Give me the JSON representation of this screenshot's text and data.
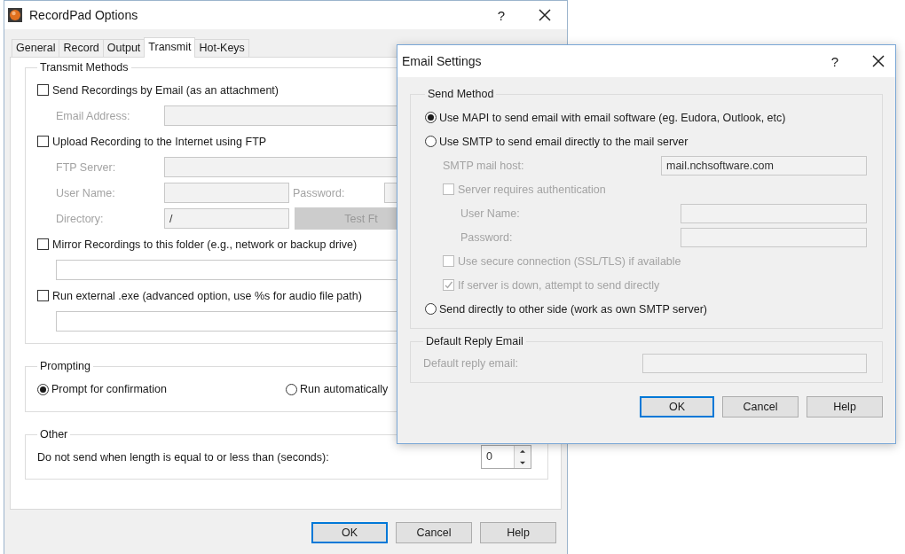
{
  "main_window": {
    "title": "RecordPad Options",
    "help": "?",
    "tabs": [
      {
        "label": "General",
        "selected": false
      },
      {
        "label": "Record",
        "selected": false
      },
      {
        "label": "Output",
        "selected": false
      },
      {
        "label": "Transmit",
        "selected": true
      },
      {
        "label": "Hot-Keys",
        "selected": false
      }
    ],
    "transmit_methods": {
      "title": "Transmit Methods",
      "rows": [
        {
          "kind": "checkbox",
          "label": "Send Recordings by Email (as an attachment)",
          "checked": false
        },
        {
          "kind": "field",
          "label": "Email Address:",
          "disabled": true
        },
        {
          "kind": "checkbox",
          "label": "Upload Recording to the Internet using FTP",
          "checked": false
        },
        {
          "kind": "field",
          "label": "FTP Server:",
          "disabled": true
        },
        {
          "kind": "field_pair",
          "fields": [
            {
              "label": "User Name:",
              "disabled": true
            },
            {
              "label": "Password:",
              "disabled": true
            }
          ]
        },
        {
          "kind": "field_button",
          "label": "Directory:",
          "value": "/",
          "disabled": true,
          "button": "Test Ft"
        },
        {
          "kind": "checkbox",
          "label": "Mirror Recordings to this folder (e.g., network or backup drive)",
          "checked": false
        },
        {
          "kind": "input"
        },
        {
          "kind": "checkbox",
          "label": "Run external .exe (advanced option, use %s for audio file path)",
          "checked": false
        },
        {
          "kind": "input"
        }
      ]
    },
    "prompting": {
      "title": "Prompting",
      "options": [
        {
          "label": "Prompt for confirmation",
          "selected": true
        },
        {
          "label": "Run automatically",
          "selected": false
        }
      ]
    },
    "other": {
      "title": "Other",
      "label": "Do not send when length is equal to or less than (seconds):",
      "value": "0"
    },
    "buttons": [
      {
        "label": "OK",
        "focused": true
      },
      {
        "label": "Cancel",
        "focused": false
      },
      {
        "label": "Help",
        "focused": false
      }
    ]
  },
  "email_settings": {
    "title": "Email Settings",
    "help": "?",
    "send_method": {
      "title": "Send Method",
      "rows": [
        {
          "kind": "radio",
          "label": "Use MAPI to send email with email software (eg. Eudora, Outlook, etc)",
          "selected": true
        },
        {
          "kind": "radio",
          "label": "Use SMTP to send email directly to the mail server",
          "selected": false,
          "children": [
            {
              "kind": "field",
              "label": "SMTP mail host:",
              "value": "mail.nchsoftware.com",
              "disabled": true
            },
            {
              "kind": "checkbox",
              "label": "Server requires authentication",
              "checked": false,
              "disabled": true,
              "children": [
                {
                  "kind": "field",
                  "label": "User Name:",
                  "disabled": true
                },
                {
                  "kind": "field",
                  "label": "Password:",
                  "disabled": true
                }
              ]
            },
            {
              "kind": "checkbox",
              "label": "Use secure connection (SSL/TLS) if available",
              "checked": false,
              "disabled": true
            },
            {
              "kind": "checkbox",
              "label": "If server is down, attempt to send directly",
              "checked": true,
              "disabled": true
            }
          ]
        },
        {
          "kind": "radio",
          "label": "Send directly to other side (work as own SMTP server)",
          "selected": false
        }
      ]
    },
    "default_reply": {
      "title": "Default Reply Email",
      "label": "Default reply email:",
      "disabled": true
    },
    "buttons": [
      {
        "label": "OK",
        "focused": true
      },
      {
        "label": "Cancel",
        "focused": false
      },
      {
        "label": "Help",
        "focused": false
      }
    ]
  }
}
